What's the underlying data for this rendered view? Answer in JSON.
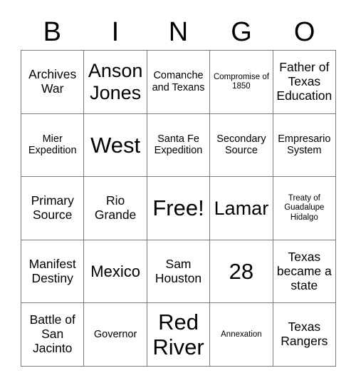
{
  "card": {
    "title": "BINGO",
    "headers": [
      "B",
      "I",
      "N",
      "G",
      "O"
    ],
    "rows": [
      [
        {
          "text": "Archives War",
          "size": "s-md"
        },
        {
          "text": "Anson Jones",
          "size": "s-xl"
        },
        {
          "text": "Comanche and Texans",
          "size": "s-sm"
        },
        {
          "text": "Compromise of 1850",
          "size": "s-xs"
        },
        {
          "text": "Father of Texas Education",
          "size": "s-md"
        }
      ],
      [
        {
          "text": "Mier Expedition",
          "size": "s-sm"
        },
        {
          "text": "West",
          "size": "s-xxl"
        },
        {
          "text": "Santa Fe Expedition",
          "size": "s-sm"
        },
        {
          "text": "Secondary Source",
          "size": "s-sm"
        },
        {
          "text": "Empresario System",
          "size": "s-sm"
        }
      ],
      [
        {
          "text": "Primary Source",
          "size": "s-md"
        },
        {
          "text": "Rio Grande",
          "size": "s-md"
        },
        {
          "text": "Free!",
          "size": "s-xxl"
        },
        {
          "text": "Lamar",
          "size": "s-xl"
        },
        {
          "text": "Treaty of Guadalupe Hidalgo",
          "size": "s-xs"
        }
      ],
      [
        {
          "text": "Manifest Destiny",
          "size": "s-md"
        },
        {
          "text": "Mexico",
          "size": "s-lg"
        },
        {
          "text": "Sam Houston",
          "size": "s-md"
        },
        {
          "text": "28",
          "size": "s-xxl"
        },
        {
          "text": "Texas became a state",
          "size": "s-md"
        }
      ],
      [
        {
          "text": "Battle of San Jacinto",
          "size": "s-md"
        },
        {
          "text": "Governor",
          "size": "s-sm"
        },
        {
          "text": "Red River",
          "size": "s-xxl"
        },
        {
          "text": "Annexation",
          "size": "s-xs"
        },
        {
          "text": "Texas Rangers",
          "size": "s-md"
        }
      ]
    ]
  },
  "colors": {
    "border": "#7a7a7a",
    "text": "#000000",
    "background": "#ffffff"
  }
}
